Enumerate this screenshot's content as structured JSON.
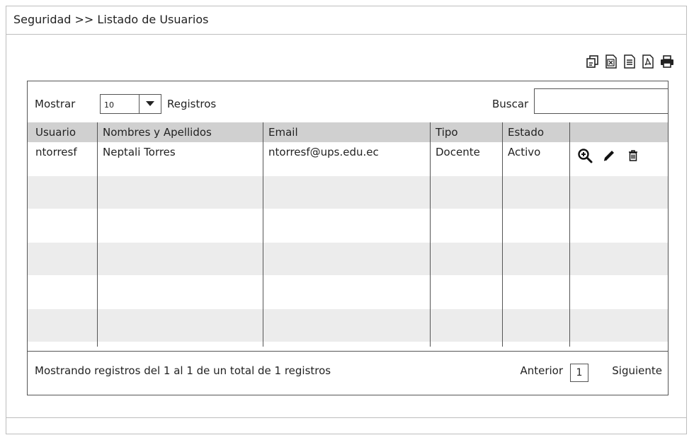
{
  "breadcrumb": "Seguridad >> Listado de Usuarios",
  "export_icons": [
    "copy-icon",
    "excel-icon",
    "csv-icon",
    "pdf-icon",
    "print-icon"
  ],
  "controls": {
    "show_label": "Mostrar",
    "page_size": "10",
    "records_label": "Registros",
    "search_label": "Buscar",
    "search_value": ""
  },
  "table": {
    "columns": [
      "Usuario",
      "Nombres y Apellidos",
      "Email",
      "Tipo",
      "Estado"
    ],
    "rows": [
      {
        "usuario": "ntorresf",
        "nombres": "Neptali Torres",
        "email": "ntorresf@ups.edu.ec",
        "tipo": "Docente",
        "estado": "Activo",
        "actions": [
          "zoom-in-icon",
          "edit-pencil-icon",
          "trash-icon"
        ]
      }
    ]
  },
  "footer": {
    "status": "Mostrando registros del 1 al 1 de un total de 1 registros",
    "prev_label": "Anterior",
    "page": "1",
    "next_label": "Siguiente"
  }
}
